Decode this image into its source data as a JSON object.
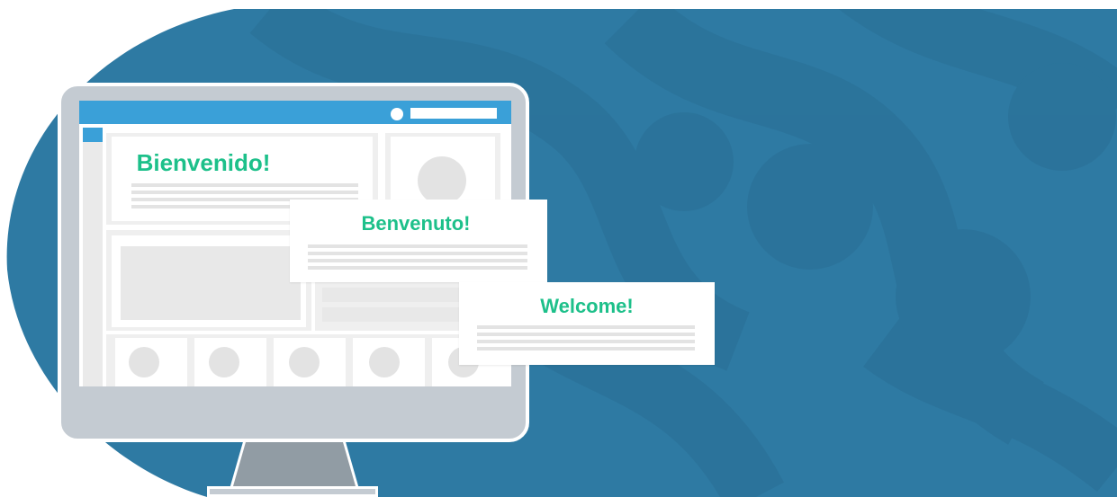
{
  "colors": {
    "background_blue": "#2e7aa3",
    "background_pattern": "#2a6f95",
    "screen_bar_blue": "#3aa0d8",
    "headline_green": "#1dc08a",
    "monitor_gray": "#c4cbd2",
    "stand_gray": "#919ca4"
  },
  "greetings": {
    "spanish": "Bienvenido!",
    "italian": "Benvenuto!",
    "english": "Welcome!"
  },
  "icons": {
    "monitor": "monitor-icon",
    "avatar": "avatar-placeholder-icon"
  }
}
